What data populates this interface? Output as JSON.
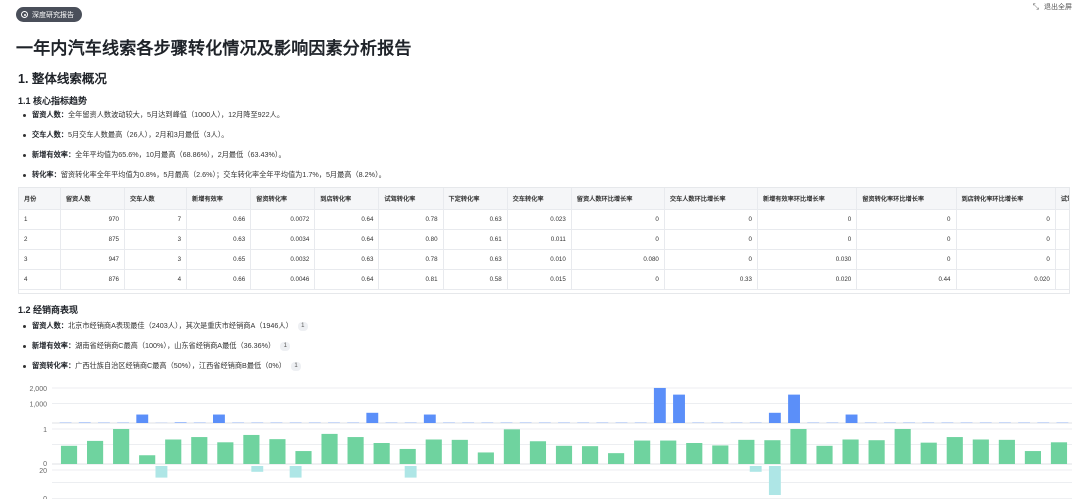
{
  "report_badge": "深度研究报告",
  "exit_fullscreen": "退出全屏",
  "title": "一年内汽车线索各步骤转化情况及影响因素分析报告",
  "section1": {
    "heading": "1. 整体线索概况",
    "sub1": {
      "heading": "1.1 核心指标趋势",
      "bullets": [
        {
          "label": "留资人数：",
          "text": "全年留资人数波动较大，5月达到峰值（1000人），12月降至922人。"
        },
        {
          "label": "交车人数：",
          "text": "5月交车人数最高（26人），2月和3月最低（3人）。"
        },
        {
          "label": "新增有效率：",
          "text": "全年平均值为65.6%，10月最高（68.86%），2月最低（63.43%）。"
        },
        {
          "label": "转化率：",
          "text": "留资转化率全年平均值为0.8%，5月最高（2.6%）；交车转化率全年平均值为1.7%，5月最高（8.2%）。"
        }
      ]
    },
    "sub2": {
      "heading": "1.2 经销商表现",
      "bullets": [
        {
          "label": "留资人数：",
          "text": "北京市经销商A表现最佳（2403人），其次是重庆市经销商A（1946人）",
          "ref": "1"
        },
        {
          "label": "新增有效率：",
          "text": "湖南省经销商C最高（100%），山东省经销商A最低（36.36%）",
          "ref": "1"
        },
        {
          "label": "留资转化率：",
          "text": "广西壮族自治区经销商C最高（50%），江西省经销商B最低（0%）",
          "ref": "1"
        }
      ]
    }
  },
  "table": {
    "headers": [
      "月份",
      "留资人数",
      "交车人数",
      "新增有效率",
      "留资转化率",
      "到店转化率",
      "试驾转化率",
      "下定转化率",
      "交车转化率",
      "留资人数环比增长率",
      "交车人数环比增长率",
      "新增有效率环比增长率",
      "留资转化率环比增长率",
      "到店转化率环比增长率",
      "试驾转化率环比"
    ],
    "rows": [
      [
        "1",
        "970",
        "7",
        "0.66",
        "0.0072",
        "0.64",
        "0.78",
        "0.63",
        "0.023",
        "0",
        "0",
        "0",
        "0",
        "0",
        ""
      ],
      [
        "2",
        "875",
        "3",
        "0.63",
        "0.0034",
        "0.64",
        "0.80",
        "0.61",
        "0.011",
        "0",
        "0",
        "0",
        "0",
        "0",
        ""
      ],
      [
        "3",
        "947",
        "3",
        "0.65",
        "0.0032",
        "0.63",
        "0.78",
        "0.63",
        "0.010",
        "0.080",
        "0",
        "0.030",
        "0",
        "0",
        ""
      ],
      [
        "4",
        "876",
        "4",
        "0.66",
        "0.0046",
        "0.64",
        "0.81",
        "0.58",
        "0.015",
        "0",
        "0.33",
        "0.020",
        "0.44",
        "0.020",
        ""
      ]
    ]
  },
  "chart_data": {
    "type": "bar",
    "panels": [
      {
        "ticks": [
          "2,000",
          "1,000"
        ],
        "range": [
          0,
          2400
        ],
        "color": "#5b8ff9",
        "values": [
          20,
          30,
          20,
          20,
          580,
          10,
          40,
          20,
          580,
          20,
          20,
          20,
          20,
          20,
          20,
          20,
          700,
          20,
          20,
          580,
          20,
          20,
          20,
          20,
          20,
          20,
          20,
          20,
          20,
          20,
          20,
          2403,
          1946,
          20,
          20,
          20,
          20,
          700,
          1946,
          20,
          20,
          580,
          20,
          20,
          20,
          20,
          20,
          20,
          20,
          20,
          20,
          20,
          20
        ]
      },
      {
        "ticks": [
          "1",
          "0"
        ],
        "range": [
          0,
          1
        ],
        "color": "#6fd39f",
        "values": [
          0.52,
          0.66,
          1.0,
          0.25,
          0.7,
          0.77,
          0.62,
          0.83,
          0.71,
          0.37,
          0.86,
          0.77,
          0.6,
          0.43,
          0.7,
          0.69,
          0.33,
          0.99,
          0.65,
          0.52,
          0.51,
          0.31,
          0.67,
          0.67,
          0.6,
          0.53,
          0.69,
          0.68,
          1.0,
          0.52,
          0.7,
          0.68,
          1.0,
          0.61,
          0.77,
          0.7,
          0.69,
          0.37,
          0.62
        ]
      },
      {
        "ticks": [
          "20",
          "0"
        ],
        "range": [
          0,
          20
        ],
        "color": "#aee6e6",
        "values": [
          0,
          0,
          0,
          0,
          0,
          8,
          0,
          0,
          0,
          0,
          4,
          0,
          8,
          0,
          0,
          0,
          0,
          0,
          8,
          0,
          0,
          0,
          0,
          0,
          0,
          0,
          0,
          0,
          0,
          0,
          0,
          0,
          0,
          0,
          0,
          0,
          4,
          20,
          0,
          0,
          0,
          0,
          0,
          0,
          0,
          0,
          0,
          0,
          0,
          0,
          0,
          0,
          0
        ]
      }
    ]
  }
}
